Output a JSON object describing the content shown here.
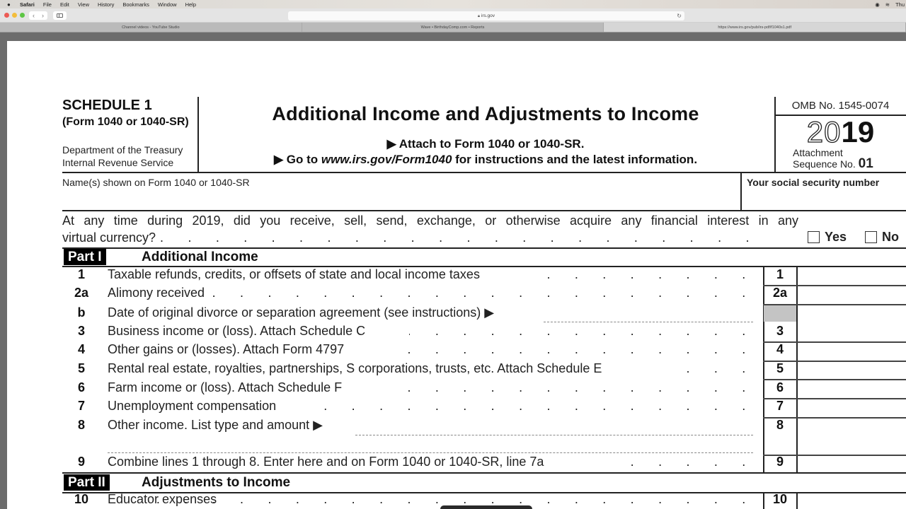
{
  "menubar": {
    "apple": "",
    "items": [
      "Safari",
      "File",
      "Edit",
      "View",
      "History",
      "Bookmarks",
      "Window",
      "Help"
    ],
    "clock": "Thu"
  },
  "browser": {
    "address": "irs.gov",
    "tabs": [
      {
        "label": "Channel videos - YouTube Studio",
        "active": false
      },
      {
        "label": "Wave • BirthdayComp.com • Reports",
        "active": false
      },
      {
        "label": "https://www.irs.gov/pub/irs-pdf/f1040s1.pdf",
        "active": true
      }
    ],
    "colors": {
      "close": "#ec5b55",
      "minimize": "#f3bd3b",
      "zoom": "#5dc645"
    }
  },
  "form": {
    "schedule": "SCHEDULE 1",
    "form_ref": "(Form 1040 or 1040-SR)",
    "dept": "Department of the Treasury",
    "irs": "Internal Revenue Service",
    "title": "Additional Income and Adjustments to Income",
    "attach": "▶ Attach to Form 1040 or 1040-SR.",
    "goto_prefix": "▶ Go to ",
    "goto_url": "www.irs.gov/Form1040",
    "goto_suffix": " for instructions and the latest information.",
    "omb": "OMB No. 1545-0074",
    "year_outline": "20",
    "year_solid": "19",
    "attachment": "Attachment",
    "sequence": "Sequence No.",
    "sequence_no": "01",
    "names_label": "Name(s) shown on Form 1040 or 1040-SR",
    "ssn_label": "Your social security number",
    "virtual_q1": "At any time during 2019, did you receive, sell, send, exchange, or otherwise acquire any financial interest in any",
    "virtual_q2": "virtual currency?",
    "yes": "Yes",
    "no": "No",
    "part1": {
      "tag": "Part I",
      "title": "Additional Income"
    },
    "part2": {
      "tag": "Part II",
      "title": "Adjustments to Income"
    },
    "lines": [
      {
        "num": "1",
        "text": "Taxable refunds, credits, or offsets of state and local income taxes",
        "box": "1"
      },
      {
        "num": "2a",
        "text": "Alimony received",
        "box": "2a"
      },
      {
        "num": "b",
        "text": "Date of original divorce or separation agreement (see instructions) ▶",
        "box": ""
      },
      {
        "num": "3",
        "text": "Business income or (loss). Attach Schedule C",
        "box": "3"
      },
      {
        "num": "4",
        "text": "Other gains or (losses). Attach Form 4797",
        "box": "4"
      },
      {
        "num": "5",
        "text": "Rental real estate, royalties, partnerships, S corporations, trusts, etc. Attach Schedule E",
        "box": "5"
      },
      {
        "num": "6",
        "text": "Farm income or (loss). Attach Schedule F",
        "box": "6"
      },
      {
        "num": "7",
        "text": "Unemployment compensation",
        "box": "7"
      },
      {
        "num": "8",
        "text": "Other income. List type and amount ▶",
        "box": "8"
      },
      {
        "num": "9",
        "text": "Combine lines 1 through 8. Enter here and on Form 1040 or 1040-SR, line 7a",
        "box": "9"
      },
      {
        "num": "10",
        "text": "Educator expenses",
        "box": "10"
      }
    ]
  }
}
